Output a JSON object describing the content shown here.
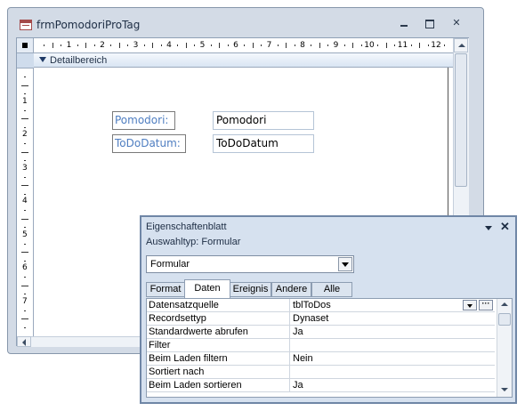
{
  "window": {
    "title": "frmPomodoriProTag"
  },
  "section": {
    "label": "Detailbereich"
  },
  "ruler": {
    "h_numbers": [
      "1",
      "2",
      "3",
      "4",
      "5",
      "6",
      "7",
      "8",
      "9",
      "10",
      "11",
      "12"
    ],
    "v_numbers": [
      "1",
      "2",
      "3",
      "4",
      "5",
      "6",
      "7"
    ]
  },
  "controls": [
    {
      "label": "Pomodori:",
      "textbox": "Pomodori"
    },
    {
      "label": "ToDoDatum:",
      "textbox": "ToDoDatum"
    }
  ],
  "property_sheet": {
    "title": "Eigenschaftenblatt",
    "selection_label": "Auswahltyp:",
    "selection_type": "Formular",
    "object_combo": "Formular",
    "tabs": [
      "Format",
      "Daten",
      "Ereignis",
      "Andere",
      "Alle"
    ],
    "active_tab": "Daten",
    "rows": [
      {
        "key": "Datensatzquelle",
        "value": "tblToDos"
      },
      {
        "key": "Recordsettyp",
        "value": "Dynaset"
      },
      {
        "key": "Standardwerte abrufen",
        "value": "Ja"
      },
      {
        "key": "Filter",
        "value": ""
      },
      {
        "key": "Beim Laden filtern",
        "value": "Nein"
      },
      {
        "key": "Sortiert nach",
        "value": ""
      },
      {
        "key": "Beim Laden sortieren",
        "value": "Ja"
      }
    ]
  },
  "icons": {
    "close": "close-icon",
    "dropdown": "chevron-down-icon",
    "build": "ellipsis-icon"
  }
}
